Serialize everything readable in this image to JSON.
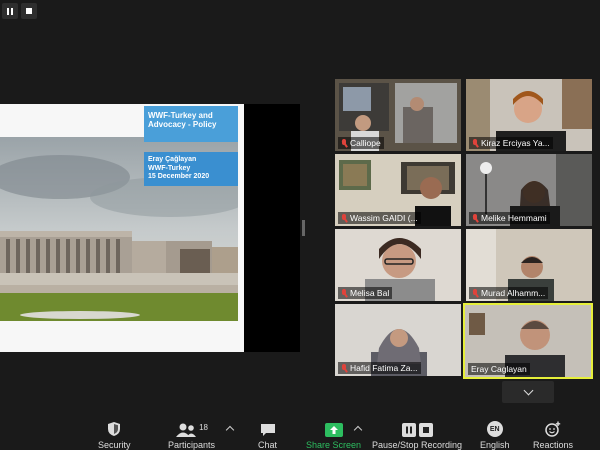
{
  "window": {
    "top_buttons": [
      {
        "icon": "pause-bars-icon"
      },
      {
        "icon": "stop-square-icon"
      }
    ]
  },
  "shared_slide": {
    "title": "WWF-Turkey and Advocacy - Policy",
    "presenter": "Eray Çağlayan",
    "organization": "WWF-Turkey",
    "date": "15 December 2020"
  },
  "participants": [
    {
      "name": "Calliope",
      "muted": true
    },
    {
      "name": "Kiraz Erciyas Ya...",
      "muted": true
    },
    {
      "name": "Wassim GAIDI (...",
      "muted": true
    },
    {
      "name": "Melike Hemmami",
      "muted": true
    },
    {
      "name": "Melisa Bal",
      "muted": true
    },
    {
      "name": "Murad Alhamm...",
      "muted": true
    },
    {
      "name": "Hafid Fatima Za...",
      "muted": true
    },
    {
      "name": "Eray Caglayan",
      "muted": false,
      "active_speaker": true
    }
  ],
  "toolbar": {
    "security": "Security",
    "participants": "Participants",
    "participants_count": "18",
    "chat": "Chat",
    "share_screen": "Share Screen",
    "recording": "Pause/Stop Recording",
    "language_badge": "EN",
    "language": "English",
    "reactions": "Reactions"
  },
  "colors": {
    "background": "#1a1a1a",
    "active_speaker_border": "#e6ef3a",
    "share_green": "#2dbe60",
    "muted_red": "#e0433b",
    "slide_blue": "#4a9fd9"
  }
}
